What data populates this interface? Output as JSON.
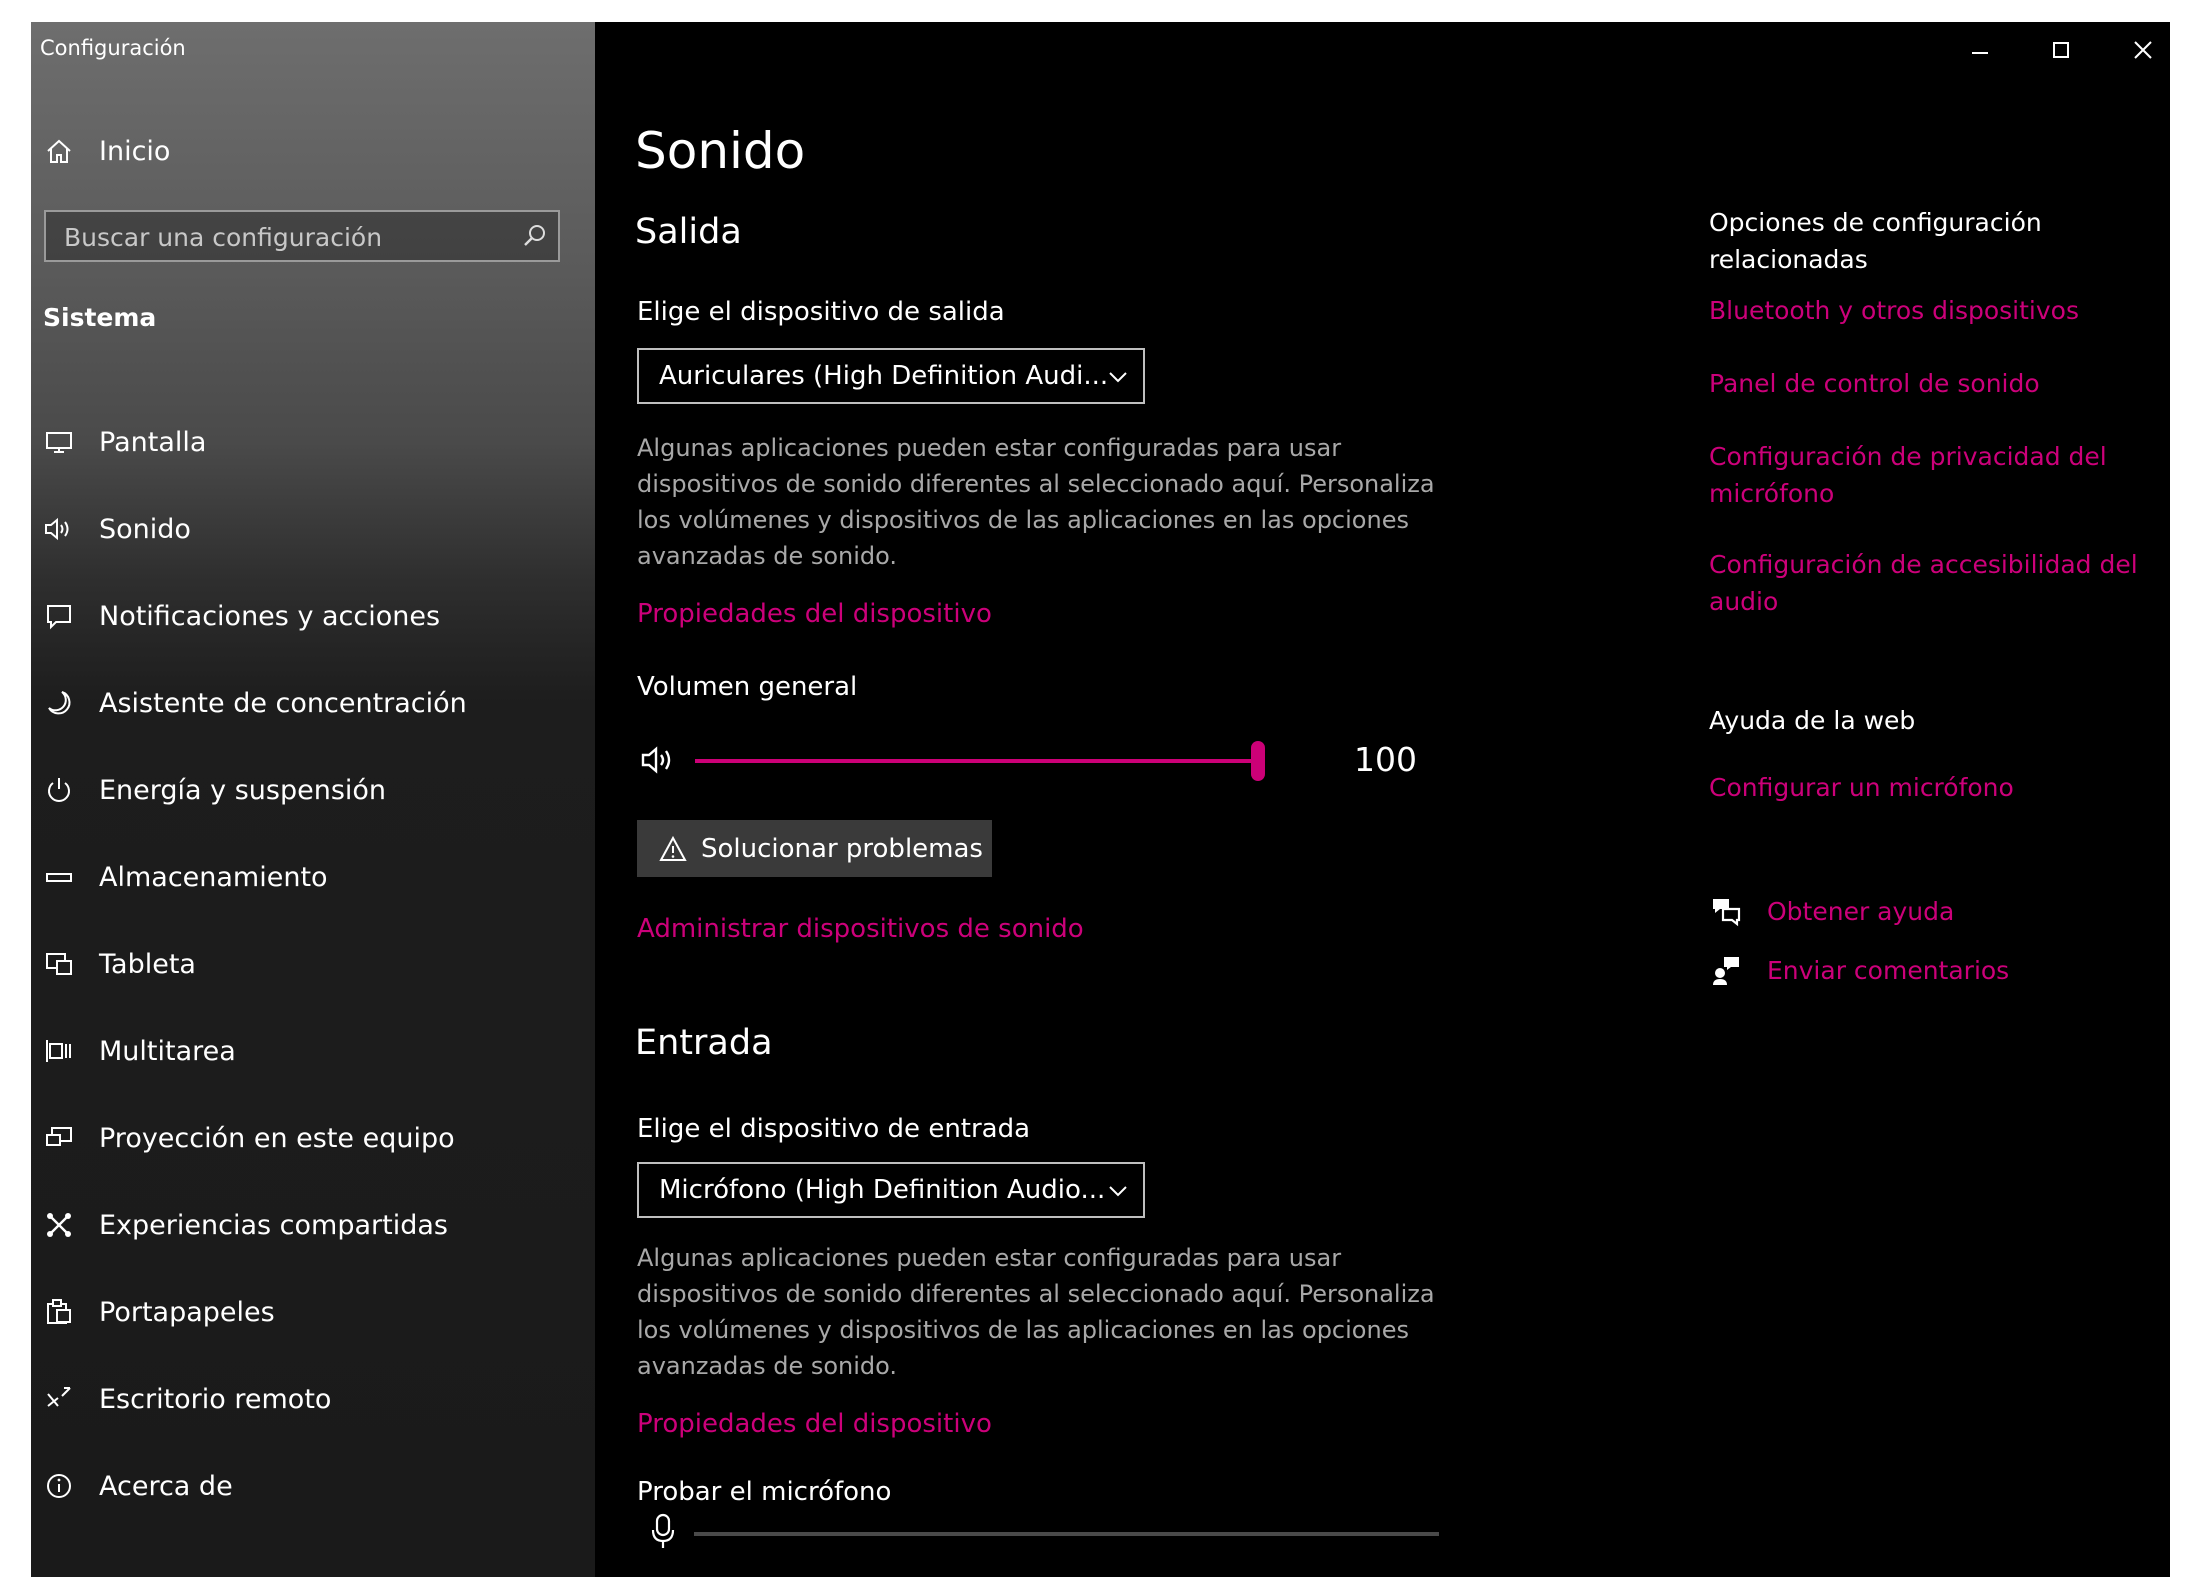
{
  "window": {
    "app_title": "Configuración",
    "controls": {
      "minimize": "minimize-icon",
      "maximize": "maximize-icon",
      "close": "close-icon"
    }
  },
  "sidebar": {
    "home": {
      "label": "Inicio",
      "icon": "home-icon"
    },
    "search": {
      "placeholder": "Buscar una configuración",
      "icon": "search-icon"
    },
    "section": "Sistema",
    "items": [
      {
        "label": "Pantalla",
        "icon": "monitor-icon"
      },
      {
        "label": "Sonido",
        "icon": "speaker-icon"
      },
      {
        "label": "Notificaciones y acciones",
        "icon": "notification-icon"
      },
      {
        "label": "Asistente de concentración",
        "icon": "moon-icon"
      },
      {
        "label": "Energía y suspensión",
        "icon": "power-icon"
      },
      {
        "label": "Almacenamiento",
        "icon": "storage-icon"
      },
      {
        "label": "Tableta",
        "icon": "tablet-icon"
      },
      {
        "label": "Multitarea",
        "icon": "multitask-icon"
      },
      {
        "label": "Proyección en este equipo",
        "icon": "projection-icon"
      },
      {
        "label": "Experiencias compartidas",
        "icon": "shared-experiences-icon"
      },
      {
        "label": "Portapapeles",
        "icon": "clipboard-icon"
      },
      {
        "label": "Escritorio remoto",
        "icon": "remote-desktop-icon"
      },
      {
        "label": "Acerca de",
        "icon": "info-icon"
      }
    ]
  },
  "main": {
    "title": "Sonido",
    "output": {
      "heading": "Salida",
      "device_label": "Elige el dispositivo de salida",
      "device_value": "Auriculares (High Definition Audi...",
      "description": "Algunas aplicaciones pueden estar configuradas para usar dispositivos de sonido diferentes al seleccionado aquí. Personaliza los volúmenes y dispositivos de las aplicaciones en las opciones avanzadas de sonido.",
      "properties_link": "Propiedades del dispositivo",
      "volume_label": "Volumen general",
      "volume_value": "100",
      "volume_fraction": 1.0,
      "troubleshoot_label": "Solucionar problemas",
      "manage_link": "Administrar dispositivos de sonido"
    },
    "input": {
      "heading": "Entrada",
      "device_label": "Elige el dispositivo de entrada",
      "device_value": "Micrófono (High Definition Audio...",
      "description": "Algunas aplicaciones pueden estar configuradas para usar dispositivos de sonido diferentes al seleccionado aquí. Personaliza los volúmenes y dispositivos de las aplicaciones en las opciones avanzadas de sonido.",
      "properties_link": "Propiedades del dispositivo",
      "test_label": "Probar el micrófono"
    }
  },
  "right_panel": {
    "related_heading": "Opciones de configuración relacionadas",
    "related_links": [
      "Bluetooth y otros dispositivos",
      "Panel de control de sonido",
      "Configuración de privacidad del micrófono",
      "Configuración de accesibilidad del audio"
    ],
    "web_help_heading": "Ayuda de la web",
    "web_help_link": "Configurar un micrófono",
    "get_help": "Obtener ayuda",
    "feedback": "Enviar comentarios"
  },
  "colors": {
    "accent": "#cc007a",
    "background": "#000000",
    "sidebar_top": "#6e6e6e",
    "sidebar_bottom": "#1a1a1a",
    "description_text": "#a8a8a8"
  }
}
